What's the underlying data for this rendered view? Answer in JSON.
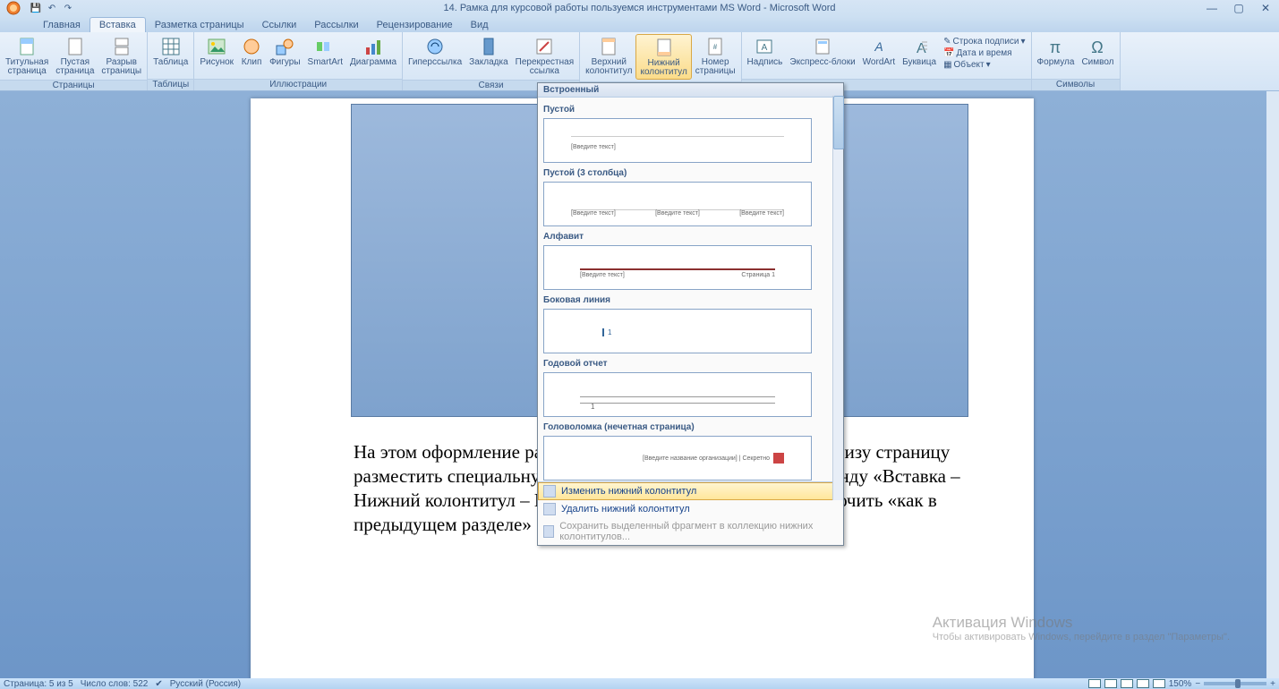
{
  "title": "14. Рамка для курсовой работы пользуемся инструментами MS Word - Microsoft Word",
  "tabs": {
    "home": "Главная",
    "insert": "Вставка",
    "layout": "Разметка страницы",
    "refs": "Ссылки",
    "mail": "Рассылки",
    "review": "Рецензирование",
    "view": "Вид"
  },
  "ribbon": {
    "pages": {
      "label": "Страницы",
      "cover": "Титульная\nстраница",
      "blank": "Пустая\nстраница",
      "break": "Разрыв\nстраницы"
    },
    "tables": {
      "label": "Таблицы",
      "table": "Таблица"
    },
    "illustrations": {
      "label": "Иллюстрации",
      "picture": "Рисунок",
      "clip": "Клип",
      "shapes": "Фигуры",
      "smartart": "SmartArt",
      "chart": "Диаграмма"
    },
    "links": {
      "label": "Связи",
      "hyperlink": "Гиперссылка",
      "bookmark": "Закладка",
      "crossref": "Перекрестная\nссылка"
    },
    "headerfooter": {
      "label": "",
      "header": "Верхний\nколонтитул",
      "footer": "Нижний\nколонтитул",
      "pagenum": "Номер\nстраницы"
    },
    "text": {
      "label": "",
      "textbox": "Надпись",
      "quickparts": "Экспресс-блоки",
      "wordart": "WordArt",
      "dropcap": "Буквица",
      "sigline": "Строка подписи",
      "datetime": "Дата и время",
      "object": "Объект"
    },
    "symbols": {
      "label": "Символы",
      "equation": "Формула",
      "symbol": "Символ"
    }
  },
  "gallery": {
    "header": "Встроенный",
    "items": {
      "blank": "Пустой",
      "blank3": "Пустой (3 столбца)",
      "alphabet": "Алфавит",
      "sideline": "Боковая линия",
      "annual": "Годовой отчет",
      "puzzle": "Головоломка (нечетная страница)"
    },
    "preview": {
      "enter_text": "[Введите текст]",
      "page1": "Страница 1",
      "org": "[Введите название организации] | Секретно"
    },
    "menu": {
      "edit": "Изменить нижний колонтитул",
      "remove": "Удалить нижний колонтитул",
      "save": "Сохранить выделенный фрагмент в коллекцию нижних колонтитулов..."
    }
  },
  "doc_text": "На этом оформление рамки закончено, теперь необходимо внизу страницу разместить специальную таблицу, для этого выполнить команду «Вставка – Нижний колонтитул – Изменить Нижний колонтитул – отключить «как в предыдущем разделе»",
  "status": {
    "page": "Страница: 5 из 5",
    "words": "Число слов: 522",
    "lang": "Русский (Россия)",
    "zoom": "150%"
  },
  "watermark": {
    "title": "Активация Windows",
    "sub": "Чтобы активировать Windows, перейдите в раздел \"Параметры\"."
  }
}
